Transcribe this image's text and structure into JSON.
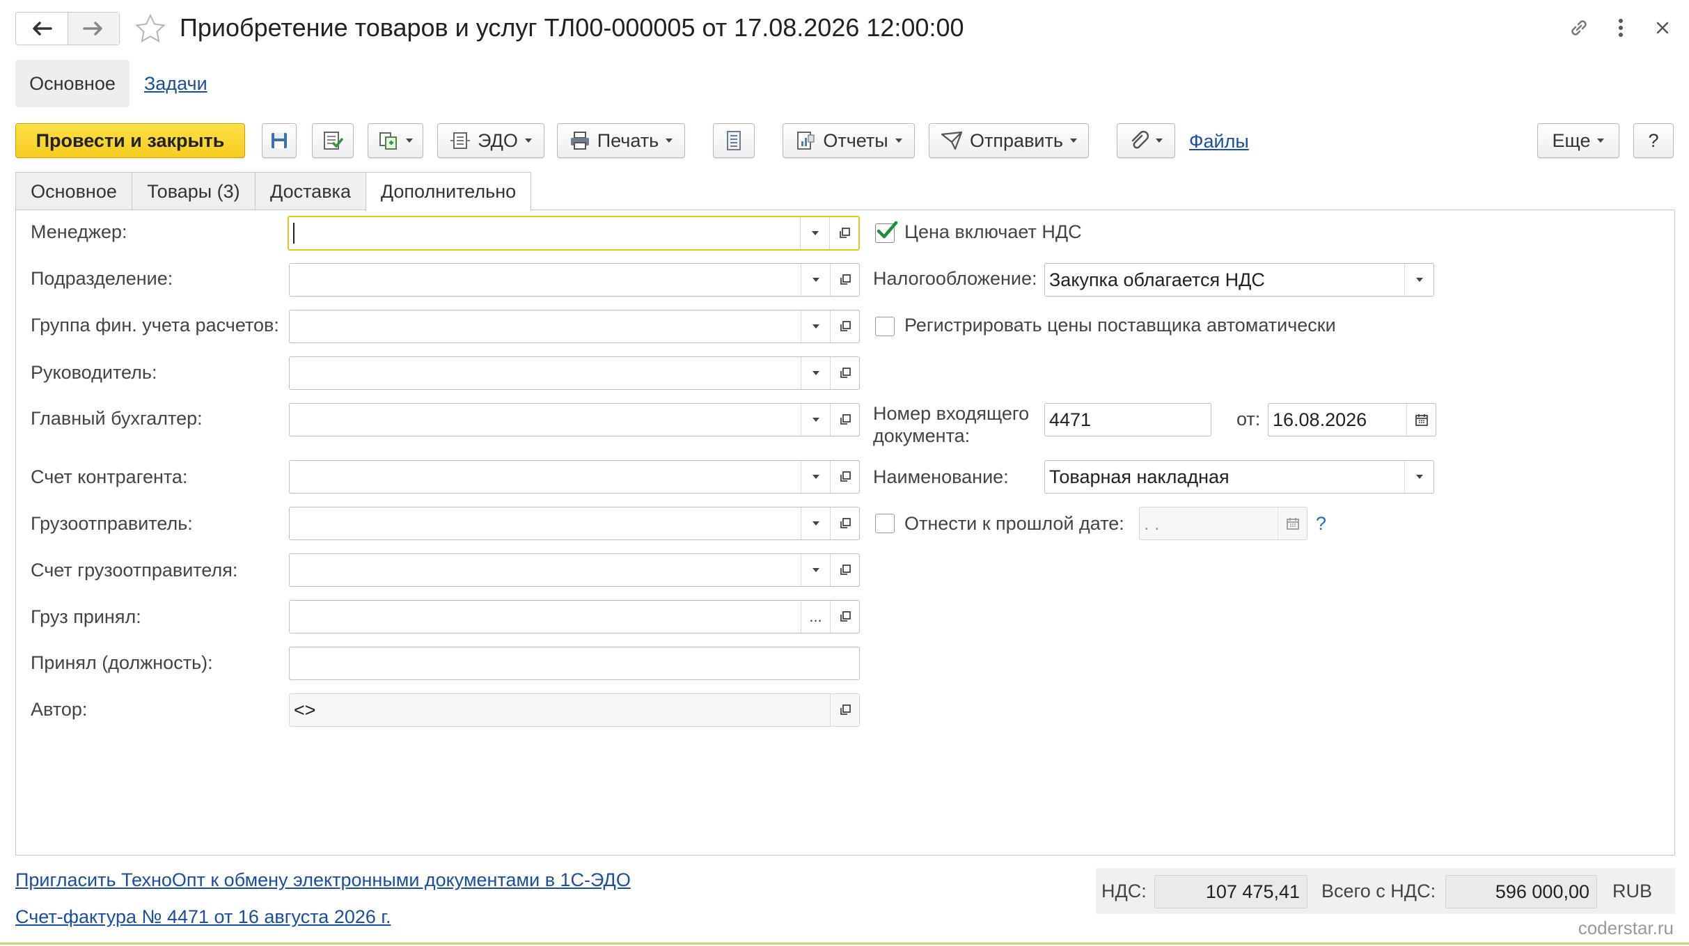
{
  "header": {
    "title": "Приобретение товаров и услуг ТЛ00-000005 от 17.08.2026 12:00:00"
  },
  "section_tabs": {
    "main": "Основное",
    "tasks": "Задачи"
  },
  "toolbar": {
    "post_close": "Провести и закрыть",
    "edo": "ЭДО",
    "print": "Печать",
    "reports": "Отчеты",
    "send": "Отправить",
    "files": "Файлы",
    "more": "Еще",
    "help": "?"
  },
  "form_tabs": [
    "Основное",
    "Товары (3)",
    "Доставка",
    "Дополнительно"
  ],
  "left_fields": {
    "manager": {
      "label": "Менеджер:",
      "value": ""
    },
    "department": {
      "label": "Подразделение:",
      "value": ""
    },
    "fin_group": {
      "label": "Группа фин. учета расчетов:",
      "value": ""
    },
    "head": {
      "label": "Руководитель:",
      "value": ""
    },
    "chief_accountant": {
      "label": "Главный бухгалтер:",
      "value": ""
    },
    "counterparty_account": {
      "label": "Счет контрагента:",
      "value": ""
    },
    "shipper": {
      "label": "Грузоотправитель:",
      "value": ""
    },
    "shipper_account": {
      "label": "Счет грузоотправителя:",
      "value": ""
    },
    "cargo_received": {
      "label": "Груз принял:",
      "value": ""
    },
    "received_position": {
      "label": "Принял (должность):",
      "value": ""
    },
    "author": {
      "label": "Автор:",
      "value": "<>"
    }
  },
  "right_fields": {
    "price_includes_vat": {
      "label": "Цена включает НДС",
      "checked": true
    },
    "taxation": {
      "label": "Налогообложение:",
      "value": "Закупка облагается НДС"
    },
    "register_prices": {
      "label": "Регистрировать цены поставщика автоматически",
      "checked": false
    },
    "incoming_number": {
      "label_line1": "Номер входящего",
      "label_line2": "документа:",
      "value": "4471"
    },
    "incoming_date": {
      "label": "от:",
      "value": "16.08.2026"
    },
    "name": {
      "label": "Наименование:",
      "value": "Товарная накладная"
    },
    "past_date": {
      "label": "Отнести к прошлой дате:",
      "checked": false,
      "value": " .  .",
      "help": "?"
    }
  },
  "footer": {
    "invite_link": "Пригласить ТехноОпт к обмену электронными документами в 1С-ЭДО",
    "invoice_link": "Счет-фактура № 4471 от 16 августа 2026 г.",
    "vat_label": "НДС:",
    "vat_value": "107 475,41",
    "total_label": "Всего с НДС:",
    "total_value": "596 000,00",
    "currency": "RUB",
    "watermark": "coderstar.ru"
  },
  "colors": {
    "accent_yellow": "#f5cd1e",
    "link_blue": "#1a4ea0",
    "check_green": "#1d8f3a"
  }
}
